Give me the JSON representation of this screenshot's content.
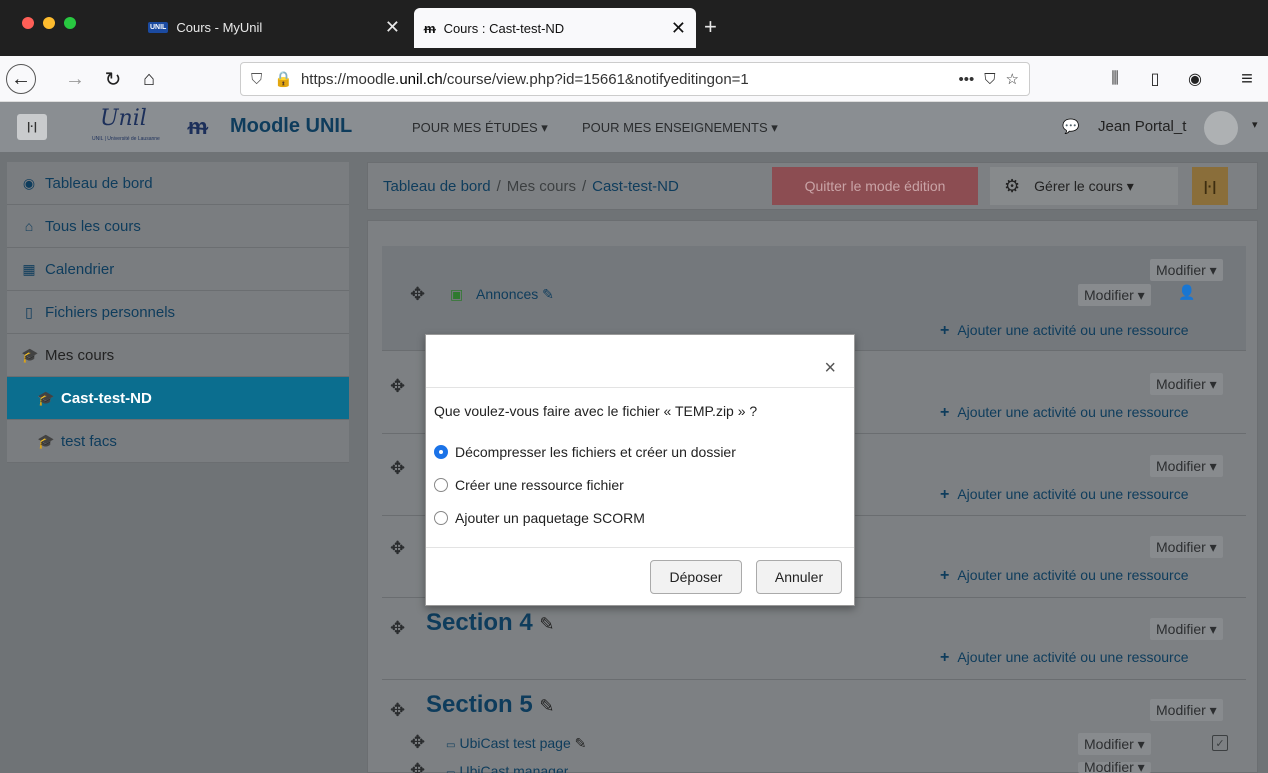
{
  "browser": {
    "tabs": [
      {
        "label": "Cours - MyUnil",
        "badge": "UNIL"
      },
      {
        "label": "Cours : Cast-test-ND"
      }
    ],
    "new_tab": "+",
    "url_prefix": "https://moodle.",
    "url_domain": "unil.ch",
    "url_path": "/course/view.php?id=15661&notifyeditingon=1",
    "more": "•••"
  },
  "moodle": {
    "brand": "Moodle UNIL",
    "unil_logo": "Unil",
    "unil_sub": "UNIL | Université de Lausanne",
    "nav_studies": "POUR MES ÉTUDES ▾",
    "nav_teaching": "POUR MES ENSEIGNEMENTS ▾",
    "user": "Jean Portal_t"
  },
  "sidebar": {
    "items": [
      {
        "label": "Tableau de bord",
        "icon": "dashboard-icon"
      },
      {
        "label": "Tous les cours",
        "icon": "home-icon"
      },
      {
        "label": "Calendrier",
        "icon": "calendar-icon"
      },
      {
        "label": "Fichiers personnels",
        "icon": "file-icon"
      },
      {
        "label": "Mes cours",
        "icon": "graduation-cap-icon"
      },
      {
        "label": "Cast-test-ND",
        "icon": "graduation-cap-icon"
      },
      {
        "label": "test facs",
        "icon": "graduation-cap-icon"
      }
    ]
  },
  "header": {
    "breadcrumb": [
      "Tableau de bord",
      "Mes cours",
      "Cast-test-ND"
    ],
    "quit_edit": "Quitter le mode édition",
    "manage": "Gérer le cours ▾"
  },
  "content": {
    "modifier": "Modifier ▾",
    "add_activity": "Ajouter une activité ou une ressource",
    "announcements": "Annonces",
    "section4": "Section 4",
    "section5": "Section 5",
    "ubicast1": "UbiCast test page",
    "ubicast2": "UbiCast manager"
  },
  "modal": {
    "question": "Que voulez-vous faire avec le fichier « TEMP.zip » ?",
    "options": [
      {
        "label": "Décompresser les fichiers et créer un dossier",
        "selected": true
      },
      {
        "label": "Créer une ressource fichier",
        "selected": false
      },
      {
        "label": "Ajouter un paquetage SCORM",
        "selected": false
      }
    ],
    "upload": "Déposer",
    "cancel": "Annuler",
    "close": "×"
  }
}
